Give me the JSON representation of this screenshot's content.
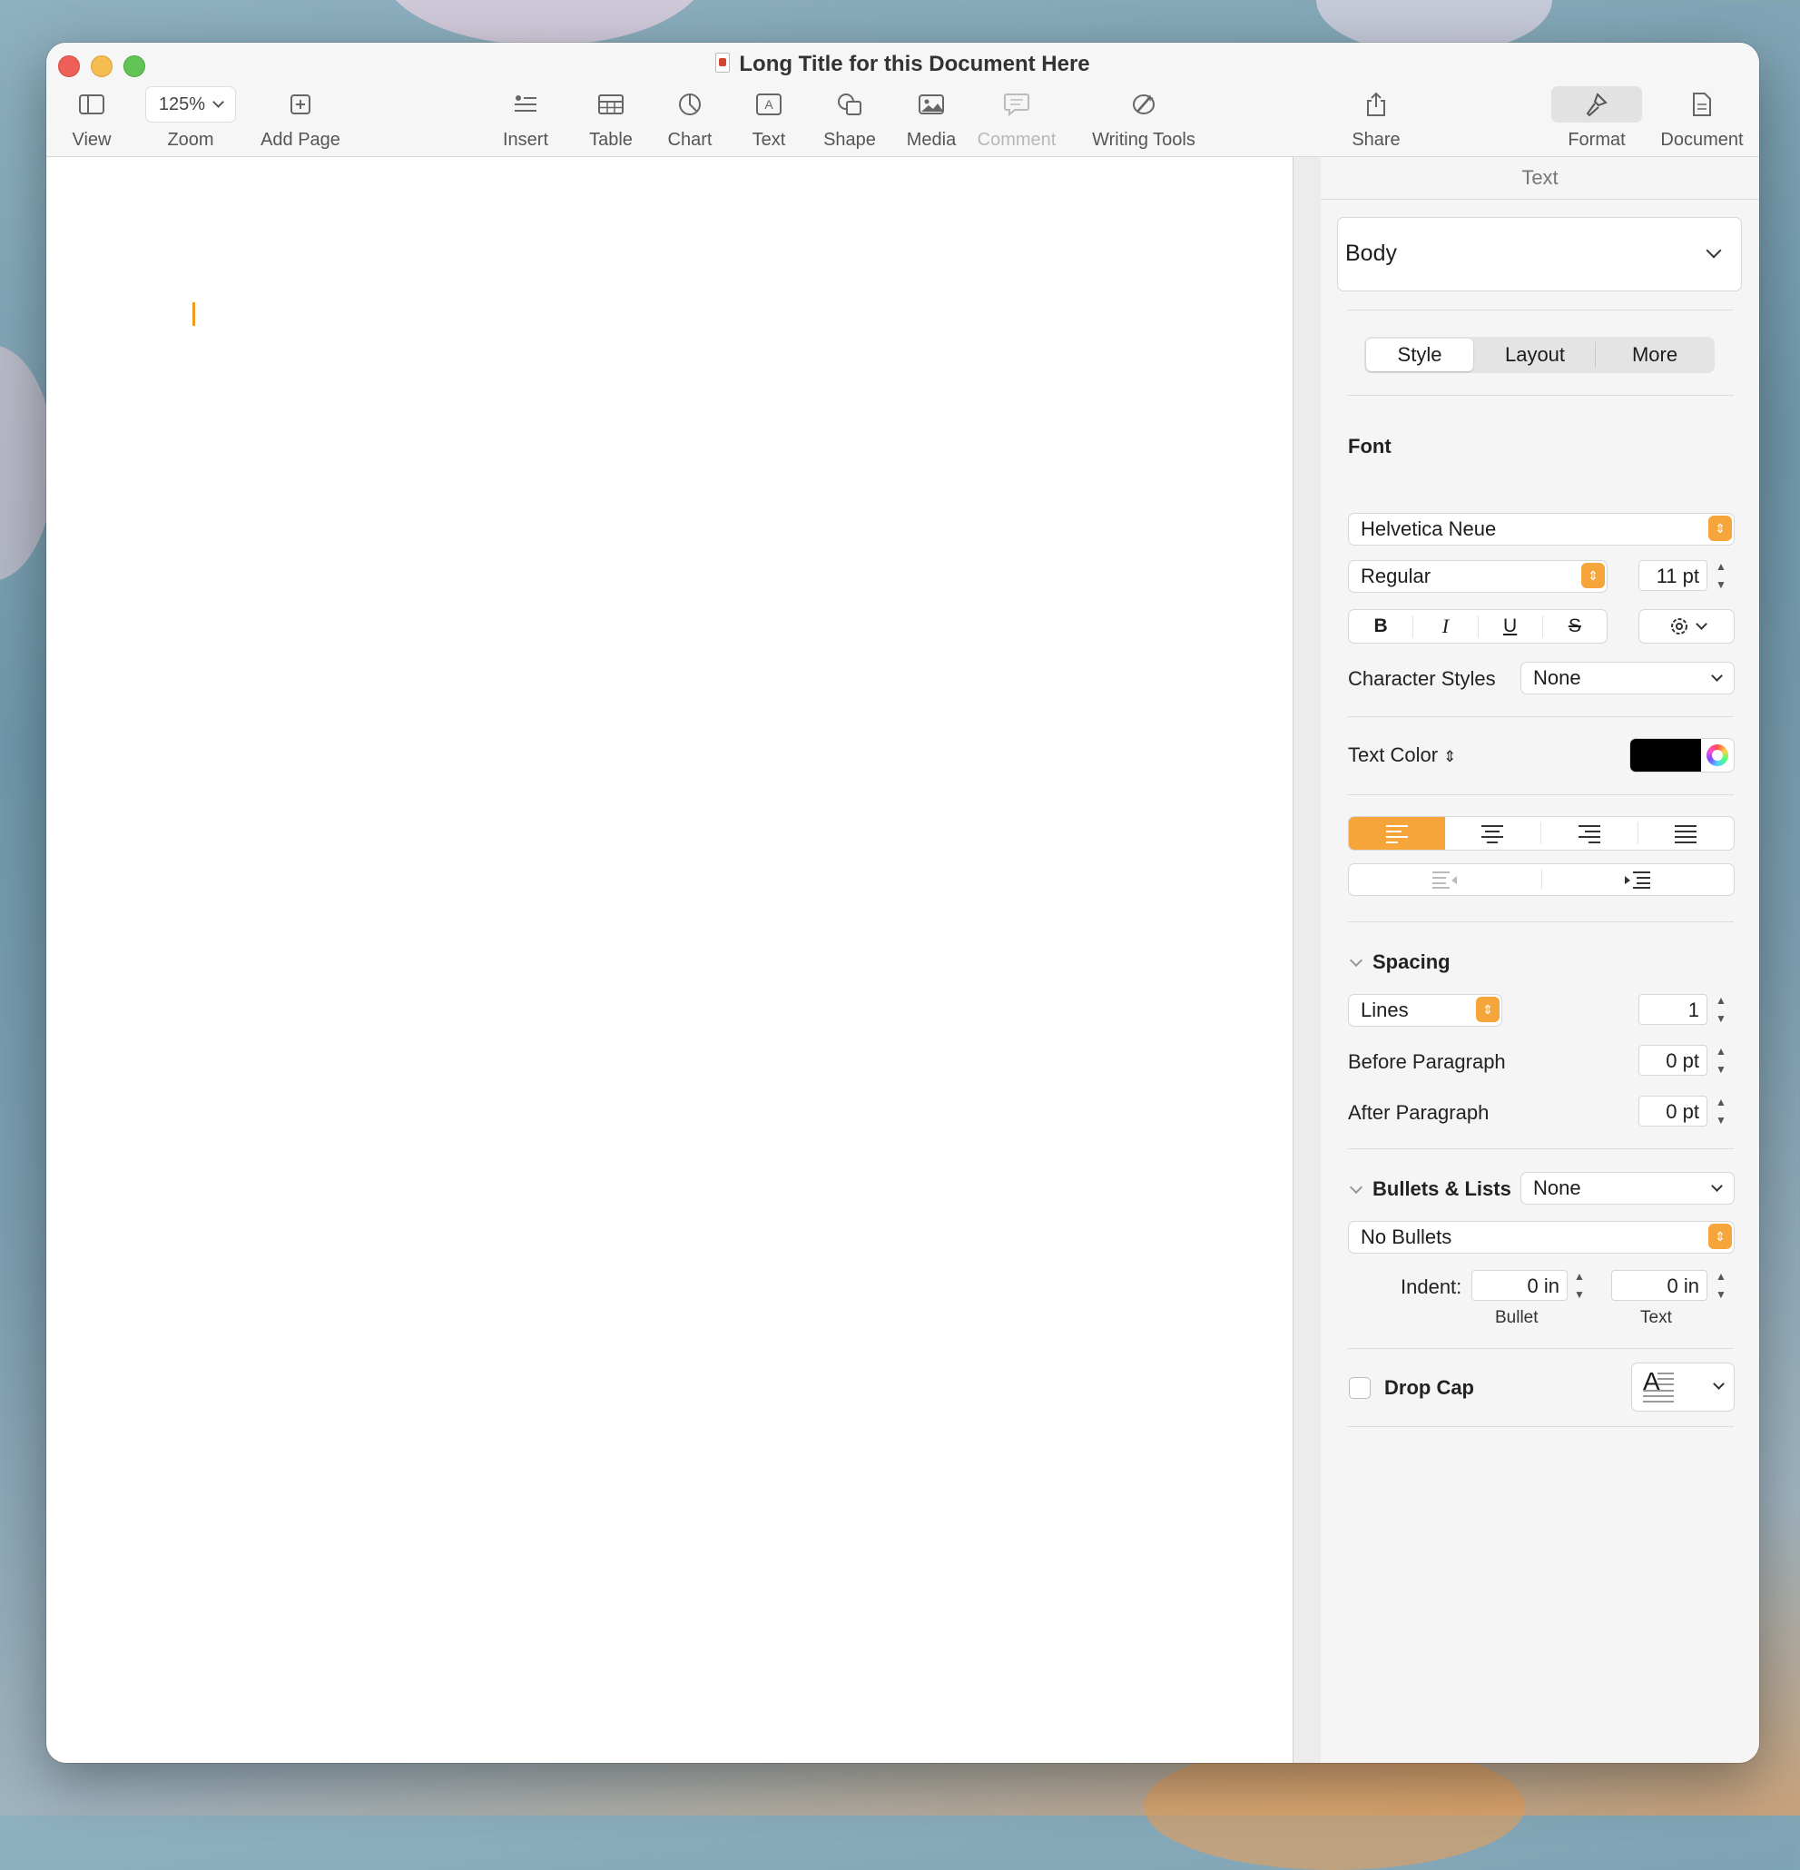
{
  "window": {
    "title": "Long Title for this Document Here"
  },
  "toolbar": {
    "view": "View",
    "zoom_value": "125%",
    "zoom": "Zoom",
    "add_page": "Add Page",
    "insert": "Insert",
    "table": "Table",
    "chart": "Chart",
    "text": "Text",
    "shape": "Shape",
    "media": "Media",
    "comment": "Comment",
    "writing_tools": "Writing Tools",
    "share": "Share",
    "format": "Format",
    "document": "Document"
  },
  "panel": {
    "header": "Text",
    "paragraph_style": "Body",
    "tabs": [
      "Style",
      "Layout",
      "More"
    ],
    "font_heading": "Font",
    "font_family": "Helvetica Neue",
    "font_weight": "Regular",
    "font_size": "11 pt",
    "bold": "B",
    "italic": "I",
    "underline": "U",
    "strike": "S",
    "char_styles_label": "Character Styles",
    "char_styles_value": "None",
    "text_color_label": "Text Color",
    "text_color_value": "#000000",
    "spacing_heading": "Spacing",
    "spacing_mode": "Lines",
    "spacing_value": "1",
    "before_label": "Before Paragraph",
    "before_value": "0 pt",
    "after_label": "After Paragraph",
    "after_value": "0 pt",
    "bullets_heading": "Bullets & Lists",
    "bullets_value": "None",
    "bullets_style": "No Bullets",
    "indent_label": "Indent:",
    "indent_bullet_value": "0 in",
    "indent_text_value": "0 in",
    "indent_bullet_caption": "Bullet",
    "indent_text_caption": "Text",
    "drop_cap_label": "Drop Cap",
    "drop_cap_preview": "A"
  },
  "colors": {
    "accent": "#f5a53a",
    "cursor": "#f19a1d"
  }
}
